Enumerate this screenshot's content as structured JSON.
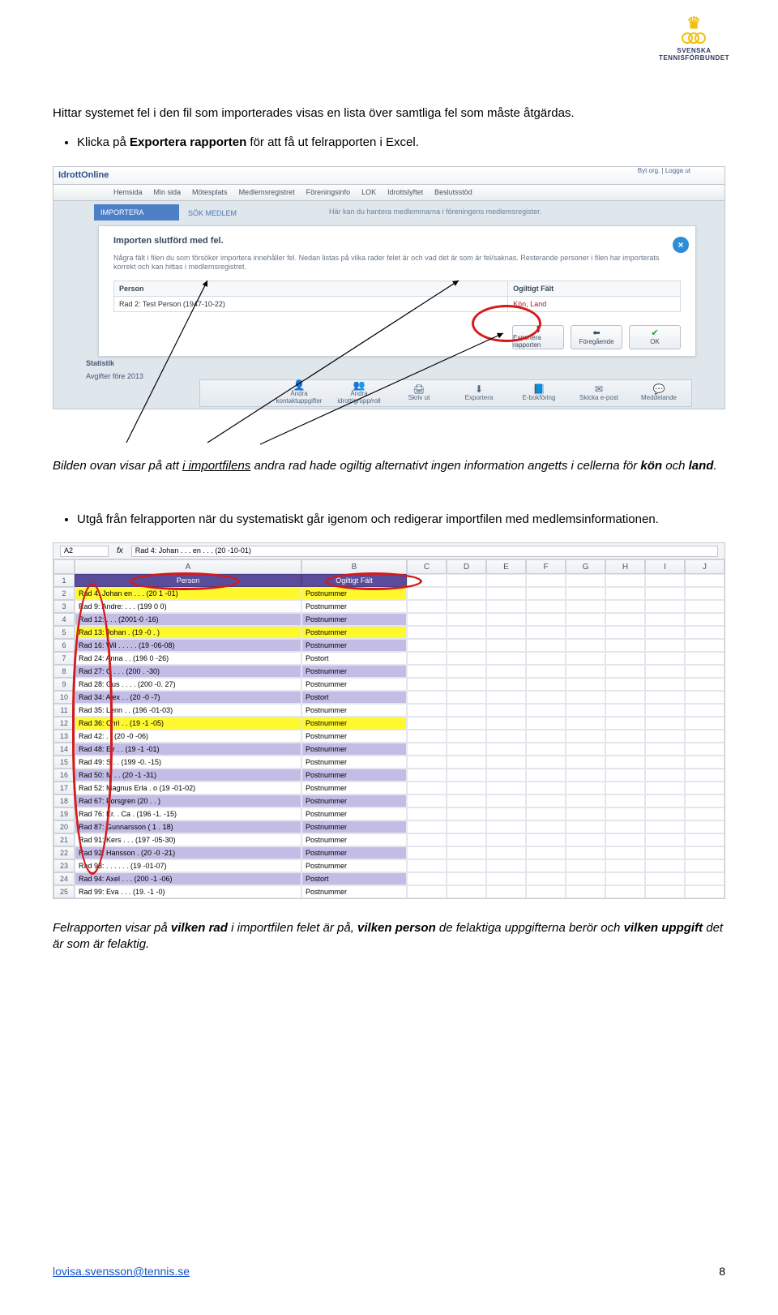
{
  "logo": {
    "line1": "SVENSKA",
    "line2": "TENNISFÖRBUNDET"
  },
  "intro": {
    "sentence": "Hittar systemet fel i den fil som importerades visas en lista över samtliga fel som måste åtgärdas.",
    "bullet1_pre": "Klicka på ",
    "bullet1_bold": "Exportera rapporten",
    "bullet1_post": " för att få ut felrapporten i Excel."
  },
  "ss1": {
    "brand": "IdrottOnline",
    "nav": [
      "Hemsida",
      "Min sida",
      "Mötesplats",
      "Medlemsregistret",
      "Föreningsinfo",
      "LOK",
      "Idrottslyftet",
      "Beslutsstöd"
    ],
    "user": "Byt org. | Logga ut",
    "importera": "IMPORTERA",
    "sok": "SÖK MEDLEM",
    "hint": "Här kan du hantera medlemmarna i föreningens medlemsregister.",
    "title": "Importen slutförd med fel.",
    "msg": "Några fält i filen du som försöker importera innehåller fel. Nedan listas på vilka rader felet är och vad det är som är fel/saknas. Resterande personer i filen har importerats korrekt och kan hittas i medlemsregistret.",
    "th1": "Person",
    "th2": "Ogiltigt Fält",
    "td1": "Rad 2: Test Person (1947-10-22)",
    "td2": "Kön, Land",
    "btn1": "Exportera rapporten",
    "btn2": "Föregående",
    "btn3": "OK",
    "toolbar": [
      "Ändra kontaktuppgifter",
      "Ändra idrott/grupp/roll",
      "Skriv ut",
      "Exportera",
      "E-bokföring",
      "Skicka e-post",
      "Meddelande"
    ],
    "side1": "Statistik",
    "side2": "Avgifter före 2013",
    "close": "×"
  },
  "caption1": {
    "pre": "Bilden ovan visar på att ",
    "u": "i importfilens",
    "mid": " andra rad hade ogiltig alternativt ingen information angetts i cellerna för ",
    "b1": "kön",
    "and": " och ",
    "b2": "land",
    "dot": "."
  },
  "bullet2": "Utgå från felrapporten när du systematiskt går igenom och redigerar importfilen med medlemsinformationen.",
  "ss2": {
    "cellref": "A2",
    "fx": "Rad 4: Johan . . . en .  . .  (20  -10-01)",
    "cols": [
      "",
      "A",
      "B",
      "C",
      "D",
      "E",
      "F",
      "G",
      "H",
      "I",
      "J"
    ],
    "h1": "Person",
    "h2": "Ogiltigt Fält",
    "rows": [
      {
        "n": "2",
        "a": "Rad 4: Johan        en . .  . (20   1 -01)",
        "b": "Postnummer",
        "cls": "r-yellow"
      },
      {
        "n": "3",
        "a": "Rad 9: Andre: .  . .   (199  0  0)",
        "b": "Postnummer",
        "cls": ""
      },
      {
        "n": "4",
        "a": "Rad 12:   .   .    . (2001-0 -16)",
        "b": "Postnummer",
        "cls": "r-lav"
      },
      {
        "n": "5",
        "a": "Rad 13: Johan     .  (19  -0  . )",
        "b": "Postnummer",
        "cls": "r-yellow"
      },
      {
        "n": "6",
        "a": "Rad 16: Wil . .  . . .   (19  -06-08)",
        "b": "Postnummer",
        "cls": "r-lav"
      },
      {
        "n": "7",
        "a": "Rad 24: Anna    .  .   (196  0 -26)",
        "b": "Postort",
        "cls": ""
      },
      {
        "n": "8",
        "a": "Rad 27: G   .  .  . (200  . -30)",
        "b": "Postnummer",
        "cls": "r-lav"
      },
      {
        "n": "9",
        "a": "Rad 28: Gus . .  .   . (200 -0.  27)",
        "b": "Postnummer",
        "cls": ""
      },
      {
        "n": "10",
        "a": "Rad 34: Alex .  .     (20  -0  -7)",
        "b": "Postort",
        "cls": "r-lav"
      },
      {
        "n": "11",
        "a": "Rad 35: Lenn  .  .  (196  -01-03)",
        "b": "Postnummer",
        "cls": ""
      },
      {
        "n": "12",
        "a": "Rad 36: Chri .  .   (19   -1 -05)",
        "b": "Postnummer",
        "cls": "r-yellow"
      },
      {
        "n": "13",
        "a": "Rad 42:  .  .      (20  -0 -06)",
        "b": "Postnummer",
        "cls": ""
      },
      {
        "n": "14",
        "a": "Rad 48: Eir .  .   (19  -1 -01)",
        "b": "Postnummer",
        "cls": "r-lav"
      },
      {
        "n": "15",
        "a": "Rad 49: S  .   .   (199  -0. -15)",
        "b": "Postnummer",
        "cls": ""
      },
      {
        "n": "16",
        "a": "Rad 50: M  .   .   (20  -1 -31)",
        "b": "Postnummer",
        "cls": "r-lav"
      },
      {
        "n": "17",
        "a": "Rad 52: Magnus  Erla . o  (19  -01-02)",
        "b": "Postnummer",
        "cls": ""
      },
      {
        "n": "18",
        "a": "Rad 67:       Forsgren (20  .   . )",
        "b": "Postnummer",
        "cls": "r-lav"
      },
      {
        "n": "19",
        "a": "Rad 76: Er.  .  Ca  .   (196  -1. -15)",
        "b": "Postnummer",
        "cls": ""
      },
      {
        "n": "20",
        "a": "Rad 87:         Gunnarsson (   1 . 18)",
        "b": "Postnummer",
        "cls": "r-lav"
      },
      {
        "n": "21",
        "a": "Rad 91: Kers .   .  .  (197  -05-30)",
        "b": "Postnummer",
        "cls": ""
      },
      {
        "n": "22",
        "a": "Rad 92:        Hansson .        (20  -0 -21)",
        "b": "Postnummer",
        "cls": "r-lav"
      },
      {
        "n": "23",
        "a": "Rad 93:  .   .  .   .  .  .  (19  -01-07)",
        "b": "Postnummer",
        "cls": ""
      },
      {
        "n": "24",
        "a": "Rad 94: Axel  .   .  .   (200  -1 -06)",
        "b": "Postort",
        "cls": "r-lav"
      },
      {
        "n": "25",
        "a": "Rad 99: Eva  .  .   .   (19.  -1  -0)",
        "b": "Postnummer",
        "cls": ""
      }
    ]
  },
  "caption2": {
    "pre": "Felrapporten visar på ",
    "b1": "vilken rad",
    "m1": " i importfilen felet är på, ",
    "b2": "vilken person",
    "m2": " de felaktiga uppgifterna berör och ",
    "b3": "vilken uppgift",
    "post": " det är som är felaktig."
  },
  "footer": {
    "link": "lovisa.svensson@tennis.se",
    "page": "8"
  }
}
